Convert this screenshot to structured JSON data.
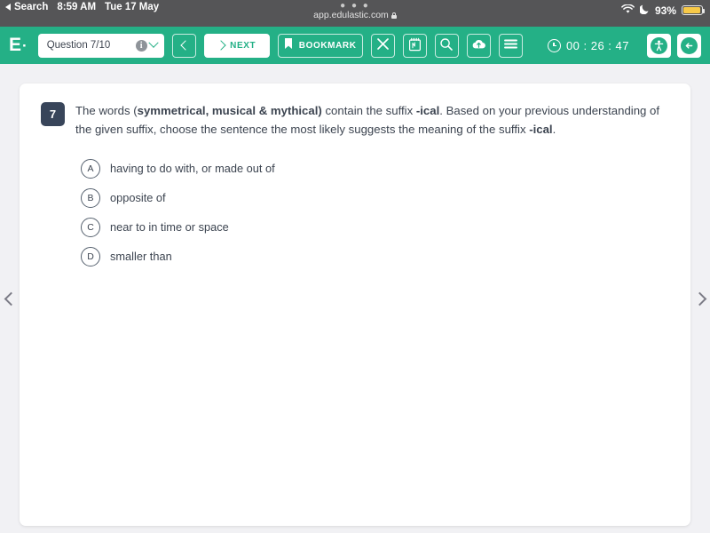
{
  "statusbar": {
    "back_label": "Search",
    "time": "8:59 AM",
    "date": "Tue 17 May",
    "url": "app.edulastic.com",
    "battery_percent": "93%",
    "wifi_icon": "wifi-icon",
    "moon_icon": "moon-icon",
    "lock_icon": "lock-icon",
    "tab_dots": "● ● ●"
  },
  "toolbar": {
    "logo": "E",
    "logo_dot": "·",
    "question_select": "Question 7/10",
    "info_glyph": "i",
    "prev_label": "",
    "next_label": "NEXT",
    "bookmark_label": "BOOKMARK",
    "icons": {
      "close": "close-icon",
      "notepad": "notepad-icon",
      "search": "search-icon",
      "cloud_save": "cloud-upload-icon",
      "menu": "hamburger-menu-icon",
      "accessibility": "accessibility-icon",
      "exit": "exit-icon"
    },
    "timer": "00 : 26 : 47",
    "accent_color": "#24b086"
  },
  "question": {
    "number": "7",
    "text_parts": [
      {
        "t": "The words (",
        "b": false
      },
      {
        "t": "symmetrical, musical & mythical)",
        "b": true
      },
      {
        "t": " contain the suffix ",
        "b": false
      },
      {
        "t": "-ical",
        "b": true
      },
      {
        "t": ". Based on your previous understanding of the given suffix, choose the sentence the most likely suggests the meaning of the suffix ",
        "b": false
      },
      {
        "t": "-ical",
        "b": true
      },
      {
        "t": ".",
        "b": false
      }
    ],
    "options": [
      {
        "letter": "A",
        "text": "having to do with, or made out of"
      },
      {
        "letter": "B",
        "text": "opposite of"
      },
      {
        "letter": "C",
        "text": "near to in time or space"
      },
      {
        "letter": "D",
        "text": "smaller than"
      }
    ]
  },
  "navigation": {
    "prev_arrow": "chevron-left-icon",
    "next_arrow": "chevron-right-icon"
  }
}
